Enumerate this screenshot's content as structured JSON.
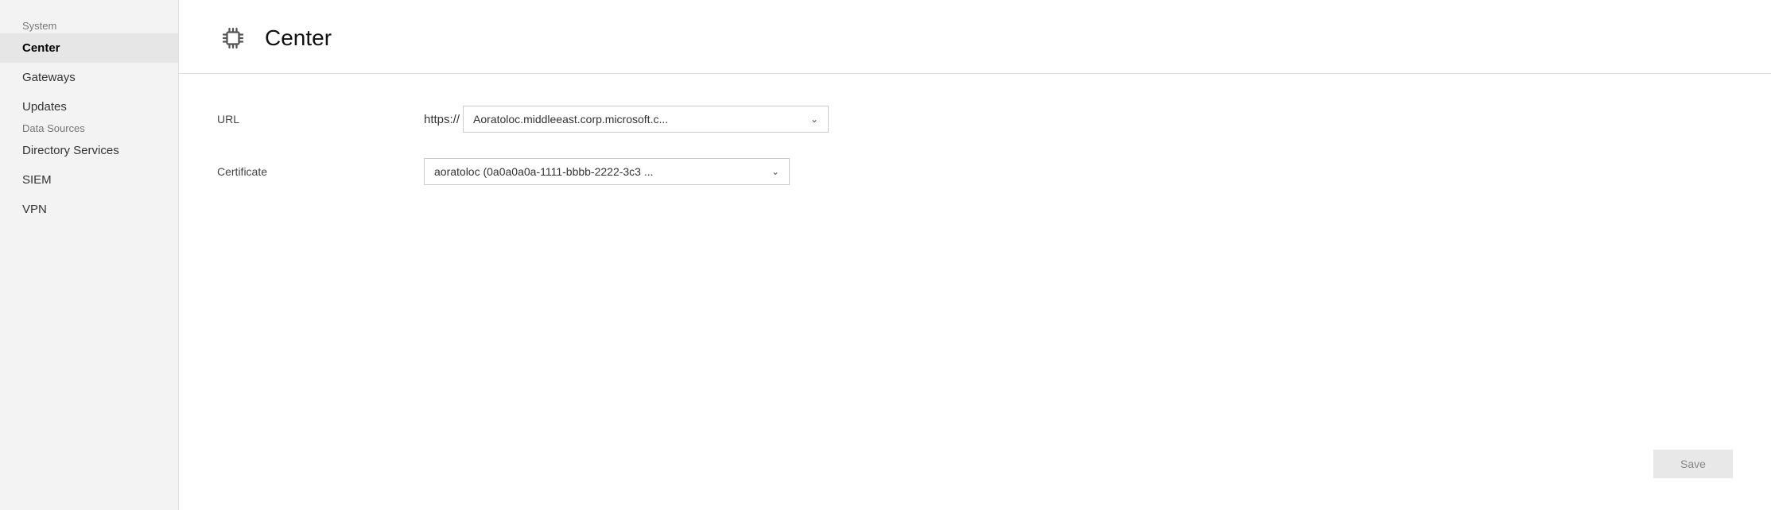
{
  "sidebar": {
    "system_label": "System",
    "data_sources_label": "Data Sources",
    "items": [
      {
        "id": "center",
        "label": "Center",
        "active": true
      },
      {
        "id": "gateways",
        "label": "Gateways",
        "active": false
      },
      {
        "id": "updates",
        "label": "Updates",
        "active": false
      },
      {
        "id": "directory-services",
        "label": "Directory Services",
        "active": false
      },
      {
        "id": "siem",
        "label": "SIEM",
        "active": false
      },
      {
        "id": "vpn",
        "label": "VPN",
        "active": false
      }
    ]
  },
  "page": {
    "title": "Center",
    "icon_label": "chip-icon"
  },
  "form": {
    "url_label": "URL",
    "url_prefix": "https://",
    "url_value": "Aoratoloc.middleeast.corp.microsoft.c...",
    "certificate_label": "Certificate",
    "certificate_value": "aoratoloc (0a0a0a0a-1111-bbbb-2222-3c3 ..."
  },
  "buttons": {
    "save_label": "Save"
  }
}
